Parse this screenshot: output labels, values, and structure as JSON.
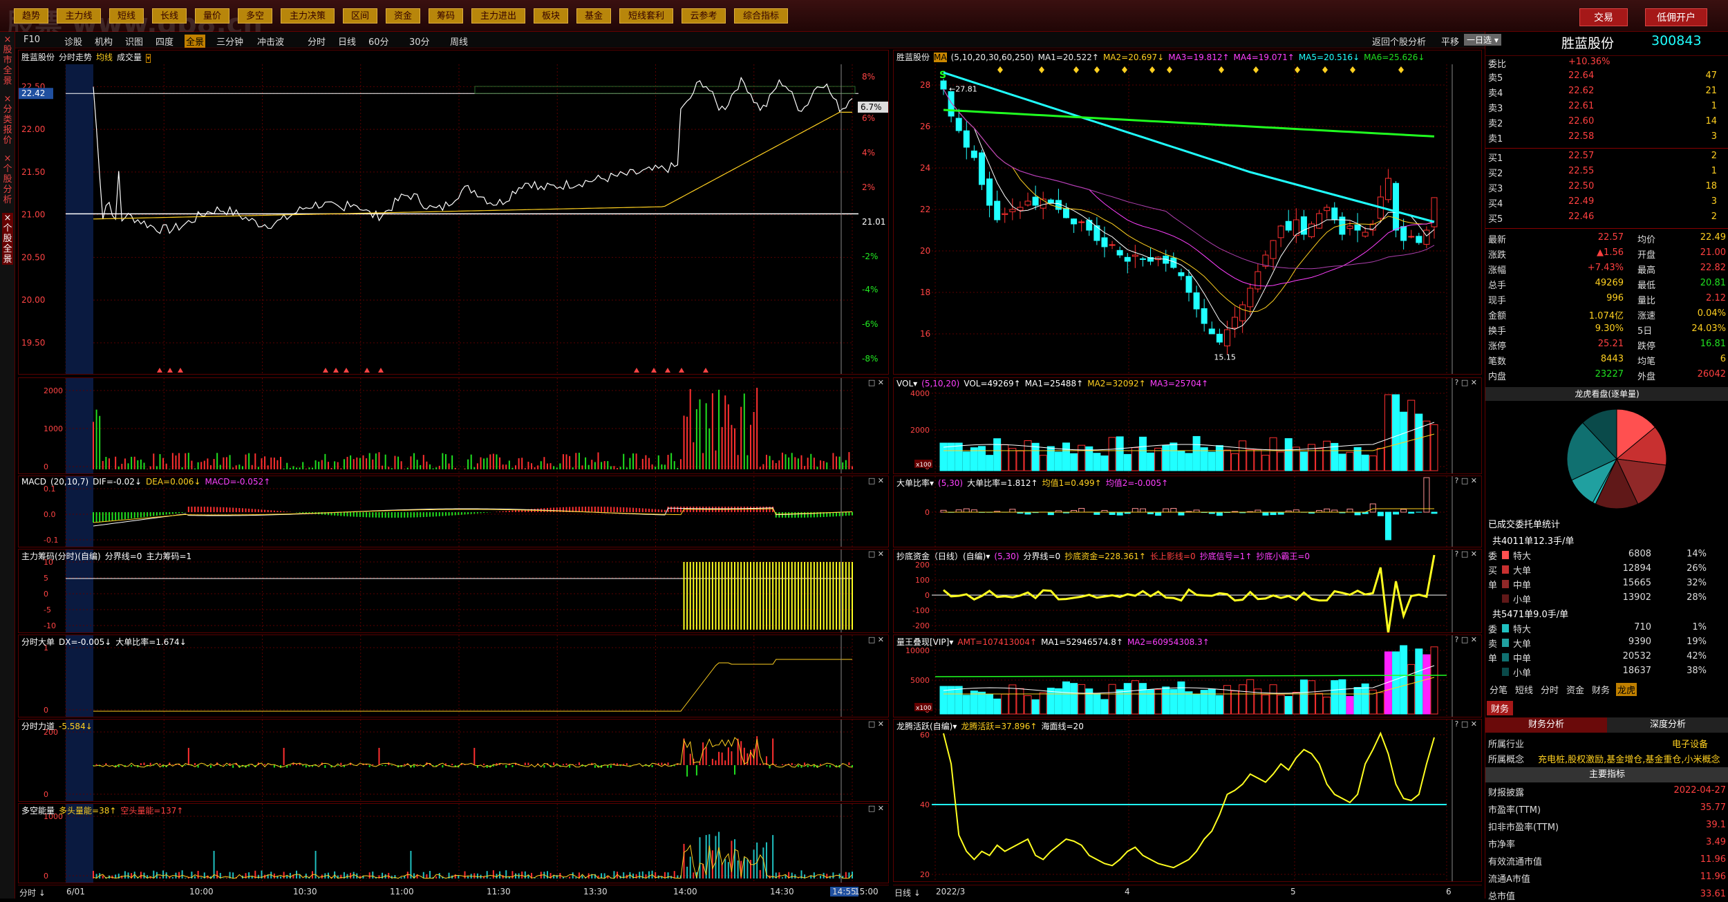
{
  "topbar": {
    "items": [
      "趋势",
      "主力线",
      "短线",
      "长线",
      "量价",
      "多空",
      "主力决策",
      "区间",
      "资金",
      "筹码",
      "主力进出",
      "板块",
      "基金",
      "短线套利",
      "云参考",
      "综合指标"
    ],
    "sell": "交易",
    "open": "低佣开户"
  },
  "watermark": "股票 www.gp8.cn",
  "toolbar2": {
    "items": [
      "F10",
      "诊股",
      "机构",
      "识图",
      "四度",
      "全景",
      "三分钟",
      "冲击波",
      "分时",
      "日线",
      "60分",
      "30分",
      "周线"
    ],
    "active": "全景",
    "right": [
      "返回个股分析",
      "平移",
      "一日选"
    ]
  },
  "lefttabs": [
    "股市全景",
    "分类报价",
    "个股分析",
    "个股全景"
  ],
  "intraday": {
    "title": "胜蓝股份",
    "sub": "分时走势",
    "ma": "均线",
    "vol": "成交量",
    "left_ticks": [
      "22.50",
      "22.42",
      "22.00",
      "21.50",
      "21.00",
      "20.50",
      "20.00",
      "19.50"
    ],
    "right_ticks": [
      "8%",
      "6.7%",
      "6%",
      "4%",
      "2%",
      "21.01",
      "-2%",
      "-4%",
      "-6%",
      "-8%"
    ],
    "time_ticks": [
      "6/01",
      "10:00",
      "10:30",
      "11:00",
      "11:30",
      "13:30",
      "14:00",
      "14:30",
      "14:55",
      "15:00"
    ],
    "minute_label": "分时"
  },
  "panels_left": [
    {
      "name": "vol",
      "title": "",
      "ticks": [
        "2000",
        "1000",
        "0"
      ]
    },
    {
      "name": "macd",
      "title": "MACD",
      "params": "(20,10,7)",
      "vals": [
        "DIF=-0.02↓",
        "DEA=0.006↓",
        "MACD=-0.052↑"
      ],
      "ticks": [
        "0.1",
        "0.0",
        "-0.1"
      ]
    },
    {
      "name": "zlcm",
      "title": "主力筹码(分时)(自编)",
      "vals": [
        "分界线=0",
        "主力筹码=1"
      ],
      "ticks": [
        "10",
        "5",
        "0",
        "-5",
        "-10"
      ]
    },
    {
      "name": "fsdd",
      "title": "分时大单",
      "vals": [
        "DX=-0.005↓",
        "大单比率=1.674↓"
      ],
      "ticks": [
        "1",
        "0"
      ]
    },
    {
      "name": "fsld",
      "title": "分时力道",
      "vals": [
        "-5.584↓"
      ],
      "ticks": [
        "200",
        "0"
      ]
    },
    {
      "name": "dkn",
      "title": "多空能量",
      "vals": [
        "多头量能=38↑",
        "空头量能=137↑"
      ],
      "ticks": [
        "1000",
        "0"
      ]
    }
  ],
  "kline": {
    "title": "胜蓝股份",
    "ma": "MA",
    "params": "(5,10,20,30,60,250)",
    "vals": [
      "MA1=20.522↑",
      "MA2=20.697↓",
      "MA3=19.812↑",
      "MA4=19.071↑",
      "MA5=20.516↓",
      "MA6=25.626↓"
    ],
    "ticks": [
      "28",
      "26",
      "24",
      "22",
      "20",
      "18",
      "16"
    ],
    "high_label": "27.81",
    "low_label": "15.15",
    "date_ticks": [
      "2022/3",
      "4",
      "5",
      "6"
    ],
    "period": "日线"
  },
  "panels_right": [
    {
      "name": "vol",
      "title": "VOL",
      "params": "(5,10,20)",
      "vals": [
        "VOL=49269↑",
        "MA1=25488↑",
        "MA2=32092↑",
        "MA3=25704↑"
      ],
      "ticks": [
        "4000",
        "2000",
        "0"
      ],
      "unit": "x100"
    },
    {
      "name": "ddbl",
      "title": "大单比率",
      "params": "(5,30)",
      "vals": [
        "大单比率=1.812↑",
        "均值1=0.499↑",
        "均值2=-0.005↑"
      ],
      "ticks": [
        "0"
      ]
    },
    {
      "name": "cdzj",
      "title": "抄底资金（日线）(自编)",
      "params": "(5,30)",
      "vals": [
        "分界线=0",
        "抄底资金=228.361↑",
        "长上影线=0",
        "抄底信号=1↑",
        "抄底小霸王=0"
      ],
      "ticks": [
        "200",
        "100",
        "0",
        "-100",
        "-200"
      ]
    },
    {
      "name": "lwxg",
      "title": "量王叠现[VIP]",
      "vals": [
        "AMT=107413004↑",
        "MA1=52946574.8↑",
        "MA2=60954308.3↑"
      ],
      "ticks": [
        "10000",
        "5000",
        "0"
      ],
      "unit": "x100"
    },
    {
      "name": "lthy",
      "title": "龙腾活跃(自编)",
      "vals": [
        "龙腾活跃=37.896↑",
        "海面线=20"
      ],
      "ticks": [
        "60",
        "40",
        "20"
      ]
    }
  ],
  "quote": {
    "name": "胜蓝股份",
    "code": "300843",
    "weibi_label": "委比",
    "weibi": "+10.36%",
    "sell": [
      [
        "卖5",
        "22.64",
        "47"
      ],
      [
        "卖4",
        "22.62",
        "21"
      ],
      [
        "卖3",
        "22.61",
        "1"
      ],
      [
        "卖2",
        "22.60",
        "14"
      ],
      [
        "卖1",
        "22.58",
        "3"
      ]
    ],
    "buy": [
      [
        "买1",
        "22.57",
        "2"
      ],
      [
        "买2",
        "22.55",
        "1"
      ],
      [
        "买3",
        "22.50",
        "18"
      ],
      [
        "买4",
        "22.49",
        "3"
      ],
      [
        "买5",
        "22.46",
        "2"
      ]
    ],
    "stats": [
      [
        "最新",
        "22.57",
        "均价",
        "22.49"
      ],
      [
        "涨跌",
        "▲1.56",
        "开盘",
        "21.00"
      ],
      [
        "涨幅",
        "+7.43%",
        "最高",
        "22.82"
      ],
      [
        "总手",
        "49269",
        "最低",
        "20.81"
      ],
      [
        "现手",
        "996",
        "量比",
        "2.12"
      ],
      [
        "金额",
        "1.074亿",
        "涨速",
        "0.04%"
      ],
      [
        "换手",
        "9.30%",
        "5日",
        "24.03%"
      ],
      [
        "涨停",
        "25.21",
        "跌停",
        "16.81"
      ],
      [
        "笔数",
        "8443",
        "均笔",
        "6"
      ],
      [
        "内盘",
        "23227",
        "外盘",
        "26042"
      ]
    ],
    "pie_title": "龙虎看盘(逐单量)",
    "pie_sub": "已成交委托单统计",
    "buy_total": "共4011单12.3手/单",
    "buy_rows": [
      [
        "特大",
        "6808",
        "14%"
      ],
      [
        "大单",
        "12894",
        "26%"
      ],
      [
        "中单",
        "15665",
        "32%"
      ],
      [
        "小单",
        "13902",
        "28%"
      ]
    ],
    "sell_total": "共5471单9.0手/单",
    "sell_rows": [
      [
        "特大",
        "710",
        "1%"
      ],
      [
        "大单",
        "9390",
        "19%"
      ],
      [
        "中单",
        "20532",
        "42%"
      ],
      [
        "小单",
        "18637",
        "38%"
      ]
    ],
    "side_buy": [
      "委",
      "买",
      "单"
    ],
    "side_sell": [
      "委",
      "卖",
      "单"
    ],
    "tabs": [
      "分笔",
      "短线",
      "分时",
      "资金",
      "财务",
      "龙虎"
    ],
    "active_tab": "龙虎",
    "fin_label": "财务",
    "fin_tabs": [
      "财务分析",
      "深度分析"
    ],
    "industry_label": "所属行业",
    "industry": "电子设备",
    "concept_label": "所属概念",
    "concept": "充电桩,股权激励,基金增仓,基金重仓,小米概念",
    "main_index": "主要指标",
    "fin_rows": [
      [
        "财报披露",
        "2022-04-27"
      ],
      [
        "市盈率(TTM)",
        "35.77"
      ],
      [
        "扣非市盈率(TTM)",
        "39.1"
      ],
      [
        "市净率",
        "3.49"
      ],
      [
        "有效流通市值",
        "11.96"
      ],
      [
        "流通A市值",
        "11.96"
      ],
      [
        "总市值",
        "33.61"
      ]
    ]
  },
  "colors": {
    "up": "#ff3030",
    "down": "#20ffff",
    "ma_white": "#ffffff",
    "ma_yellow": "#ffd020",
    "ma_pink": "#ff40ff",
    "ma_green": "#20ff20",
    "grid": "#5a0000"
  }
}
